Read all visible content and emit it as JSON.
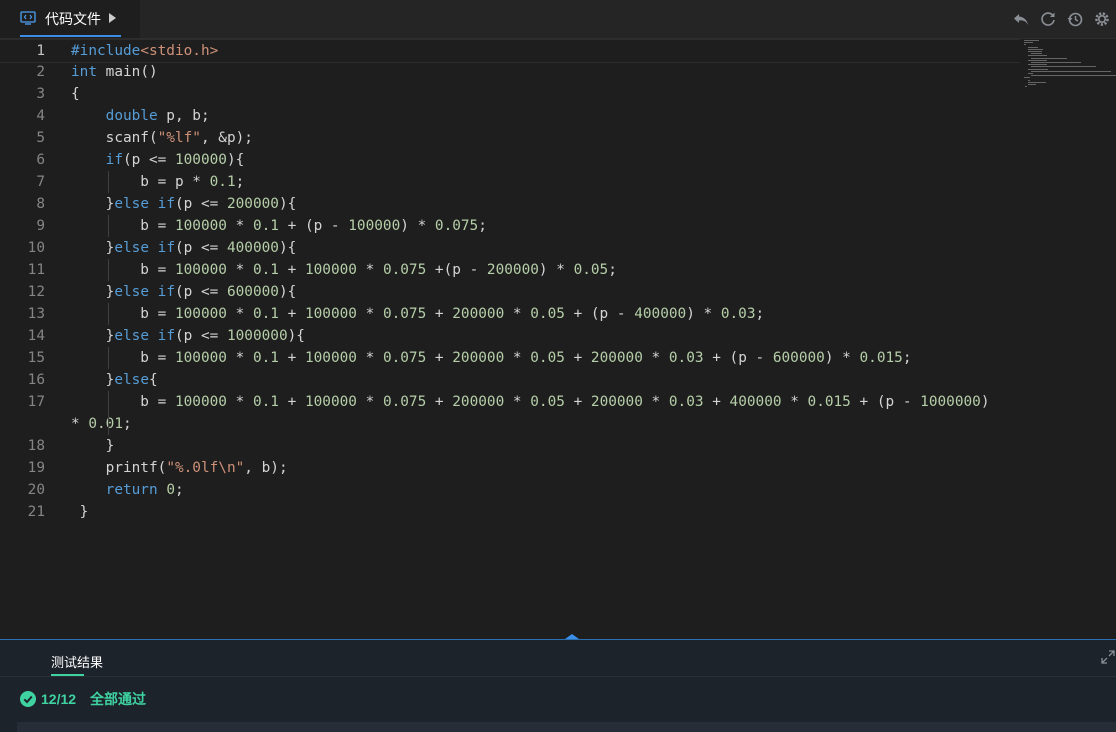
{
  "tab": {
    "label": "代码文件"
  },
  "toolbar": {
    "items": [
      "undo-icon",
      "refresh-icon",
      "restore-icon",
      "settings-icon"
    ]
  },
  "editor": {
    "line_numbers": [
      "1",
      "2",
      "3",
      "4",
      "5",
      "6",
      "7",
      "8",
      "9",
      "10",
      "11",
      "12",
      "13",
      "14",
      "15",
      "16",
      "17",
      "18",
      "19",
      "20",
      "21"
    ],
    "lines": [
      [
        {
          "t": "#include",
          "c": "kw"
        },
        {
          "t": "<stdio.h>",
          "c": "str"
        }
      ],
      [
        {
          "t": "int",
          "c": "kw"
        },
        {
          "t": " main()",
          "c": "txt"
        }
      ],
      [
        {
          "t": "{",
          "c": "txt"
        }
      ],
      [
        {
          "t": "    ",
          "c": "txt"
        },
        {
          "t": "double",
          "c": "kw"
        },
        {
          "t": " p, b;",
          "c": "txt"
        }
      ],
      [
        {
          "t": "    scanf(",
          "c": "txt"
        },
        {
          "t": "\"%lf\"",
          "c": "str"
        },
        {
          "t": ", &p);",
          "c": "txt"
        }
      ],
      [
        {
          "t": "    ",
          "c": "txt"
        },
        {
          "t": "if",
          "c": "kw"
        },
        {
          "t": "(p <= ",
          "c": "txt"
        },
        {
          "t": "100000",
          "c": "num"
        },
        {
          "t": "){",
          "c": "txt"
        }
      ],
      [
        {
          "t": "        b = p * ",
          "c": "txt"
        },
        {
          "t": "0.1",
          "c": "num"
        },
        {
          "t": ";",
          "c": "txt"
        }
      ],
      [
        {
          "t": "    }",
          "c": "txt"
        },
        {
          "t": "else",
          "c": "kw"
        },
        {
          "t": " ",
          "c": "txt"
        },
        {
          "t": "if",
          "c": "kw"
        },
        {
          "t": "(p <= ",
          "c": "txt"
        },
        {
          "t": "200000",
          "c": "num"
        },
        {
          "t": "){",
          "c": "txt"
        }
      ],
      [
        {
          "t": "        b = ",
          "c": "txt"
        },
        {
          "t": "100000",
          "c": "num"
        },
        {
          "t": " * ",
          "c": "txt"
        },
        {
          "t": "0.1",
          "c": "num"
        },
        {
          "t": " + (p - ",
          "c": "txt"
        },
        {
          "t": "100000",
          "c": "num"
        },
        {
          "t": ") * ",
          "c": "txt"
        },
        {
          "t": "0.075",
          "c": "num"
        },
        {
          "t": ";",
          "c": "txt"
        }
      ],
      [
        {
          "t": "    }",
          "c": "txt"
        },
        {
          "t": "else",
          "c": "kw"
        },
        {
          "t": " ",
          "c": "txt"
        },
        {
          "t": "if",
          "c": "kw"
        },
        {
          "t": "(p <= ",
          "c": "txt"
        },
        {
          "t": "400000",
          "c": "num"
        },
        {
          "t": "){",
          "c": "txt"
        }
      ],
      [
        {
          "t": "        b = ",
          "c": "txt"
        },
        {
          "t": "100000",
          "c": "num"
        },
        {
          "t": " * ",
          "c": "txt"
        },
        {
          "t": "0.1",
          "c": "num"
        },
        {
          "t": " + ",
          "c": "txt"
        },
        {
          "t": "100000",
          "c": "num"
        },
        {
          "t": " * ",
          "c": "txt"
        },
        {
          "t": "0.075",
          "c": "num"
        },
        {
          "t": " +(p - ",
          "c": "txt"
        },
        {
          "t": "200000",
          "c": "num"
        },
        {
          "t": ") * ",
          "c": "txt"
        },
        {
          "t": "0.05",
          "c": "num"
        },
        {
          "t": ";",
          "c": "txt"
        }
      ],
      [
        {
          "t": "    }",
          "c": "txt"
        },
        {
          "t": "else",
          "c": "kw"
        },
        {
          "t": " ",
          "c": "txt"
        },
        {
          "t": "if",
          "c": "kw"
        },
        {
          "t": "(p <= ",
          "c": "txt"
        },
        {
          "t": "600000",
          "c": "num"
        },
        {
          "t": "){",
          "c": "txt"
        }
      ],
      [
        {
          "t": "        b = ",
          "c": "txt"
        },
        {
          "t": "100000",
          "c": "num"
        },
        {
          "t": " * ",
          "c": "txt"
        },
        {
          "t": "0.1",
          "c": "num"
        },
        {
          "t": " + ",
          "c": "txt"
        },
        {
          "t": "100000",
          "c": "num"
        },
        {
          "t": " * ",
          "c": "txt"
        },
        {
          "t": "0.075",
          "c": "num"
        },
        {
          "t": " + ",
          "c": "txt"
        },
        {
          "t": "200000",
          "c": "num"
        },
        {
          "t": " * ",
          "c": "txt"
        },
        {
          "t": "0.05",
          "c": "num"
        },
        {
          "t": " + (p - ",
          "c": "txt"
        },
        {
          "t": "400000",
          "c": "num"
        },
        {
          "t": ") * ",
          "c": "txt"
        },
        {
          "t": "0.03",
          "c": "num"
        },
        {
          "t": ";",
          "c": "txt"
        }
      ],
      [
        {
          "t": "    }",
          "c": "txt"
        },
        {
          "t": "else",
          "c": "kw"
        },
        {
          "t": " ",
          "c": "txt"
        },
        {
          "t": "if",
          "c": "kw"
        },
        {
          "t": "(p <= ",
          "c": "txt"
        },
        {
          "t": "1000000",
          "c": "num"
        },
        {
          "t": "){",
          "c": "txt"
        }
      ],
      [
        {
          "t": "        b = ",
          "c": "txt"
        },
        {
          "t": "100000",
          "c": "num"
        },
        {
          "t": " * ",
          "c": "txt"
        },
        {
          "t": "0.1",
          "c": "num"
        },
        {
          "t": " + ",
          "c": "txt"
        },
        {
          "t": "100000",
          "c": "num"
        },
        {
          "t": " * ",
          "c": "txt"
        },
        {
          "t": "0.075",
          "c": "num"
        },
        {
          "t": " + ",
          "c": "txt"
        },
        {
          "t": "200000",
          "c": "num"
        },
        {
          "t": " * ",
          "c": "txt"
        },
        {
          "t": "0.05",
          "c": "num"
        },
        {
          "t": " + ",
          "c": "txt"
        },
        {
          "t": "200000",
          "c": "num"
        },
        {
          "t": " * ",
          "c": "txt"
        },
        {
          "t": "0.03",
          "c": "num"
        },
        {
          "t": " + (p - ",
          "c": "txt"
        },
        {
          "t": "600000",
          "c": "num"
        },
        {
          "t": ") * ",
          "c": "txt"
        },
        {
          "t": "0.015",
          "c": "num"
        },
        {
          "t": ";",
          "c": "txt"
        }
      ],
      [
        {
          "t": "    }",
          "c": "txt"
        },
        {
          "t": "else",
          "c": "kw"
        },
        {
          "t": "{",
          "c": "txt"
        }
      ],
      [
        {
          "t": "        b = ",
          "c": "txt"
        },
        {
          "t": "100000",
          "c": "num"
        },
        {
          "t": " * ",
          "c": "txt"
        },
        {
          "t": "0.1",
          "c": "num"
        },
        {
          "t": " + ",
          "c": "txt"
        },
        {
          "t": "100000",
          "c": "num"
        },
        {
          "t": " * ",
          "c": "txt"
        },
        {
          "t": "0.075",
          "c": "num"
        },
        {
          "t": " + ",
          "c": "txt"
        },
        {
          "t": "200000",
          "c": "num"
        },
        {
          "t": " * ",
          "c": "txt"
        },
        {
          "t": "0.05",
          "c": "num"
        },
        {
          "t": " + ",
          "c": "txt"
        },
        {
          "t": "200000",
          "c": "num"
        },
        {
          "t": " * ",
          "c": "txt"
        },
        {
          "t": "0.03",
          "c": "num"
        },
        {
          "t": " + ",
          "c": "txt"
        },
        {
          "t": "400000",
          "c": "num"
        },
        {
          "t": " * ",
          "c": "txt"
        },
        {
          "t": "0.015",
          "c": "num"
        },
        {
          "t": " + (p - ",
          "c": "txt"
        },
        {
          "t": "1000000",
          "c": "num"
        },
        {
          "t": ")",
          "c": "txt"
        }
      ],
      [
        {
          "t": "* ",
          "c": "txt"
        },
        {
          "t": "0.01",
          "c": "num"
        },
        {
          "t": ";",
          "c": "txt"
        }
      ],
      [
        {
          "t": "    }",
          "c": "txt"
        }
      ],
      [
        {
          "t": "    printf(",
          "c": "txt"
        },
        {
          "t": "\"%.0lf\\n\"",
          "c": "str"
        },
        {
          "t": ", b);",
          "c": "txt"
        }
      ],
      [
        {
          "t": "    ",
          "c": "txt"
        },
        {
          "t": "return",
          "c": "kw"
        },
        {
          "t": " ",
          "c": "txt"
        },
        {
          "t": "0",
          "c": "num"
        },
        {
          "t": ";",
          "c": "txt"
        }
      ],
      [
        {
          "t": " }",
          "c": "txt"
        }
      ]
    ]
  },
  "results": {
    "tab_label": "测试结果",
    "count": "12/12",
    "status": "全部通过",
    "accent_color": "#3fd3a1"
  }
}
